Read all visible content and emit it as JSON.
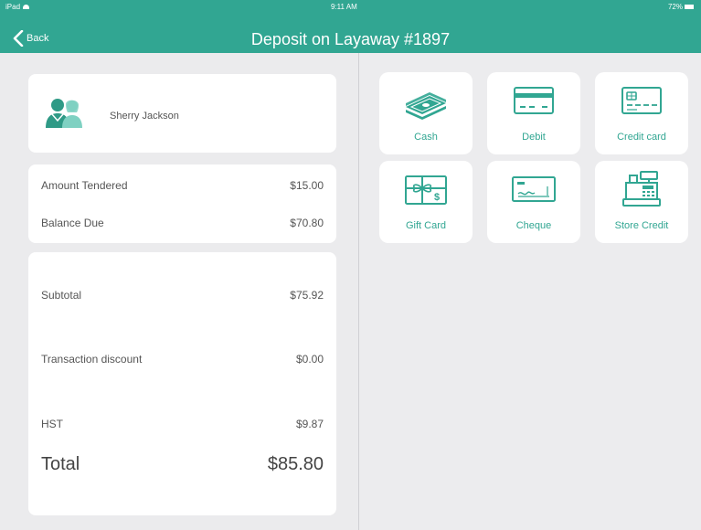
{
  "status": {
    "device": "iPad",
    "time": "9:11 AM",
    "battery": "72%"
  },
  "header": {
    "back_label": "Back",
    "title": "Deposit on Layaway #1897"
  },
  "customer": {
    "name": "Sherry Jackson"
  },
  "tender": {
    "amount_tendered_label": "Amount Tendered",
    "amount_tendered_value": "$15.00",
    "balance_due_label": "Balance Due",
    "balance_due_value": "$70.80"
  },
  "totals": {
    "subtotal_label": "Subtotal",
    "subtotal_value": "$75.92",
    "discount_label": "Transaction discount",
    "discount_value": "$0.00",
    "tax_label": "HST",
    "tax_value": "$9.87",
    "total_label": "Total",
    "total_value": "$85.80"
  },
  "payment_methods": [
    {
      "label": "Cash",
      "icon": "cash-icon"
    },
    {
      "label": "Debit",
      "icon": "debit-card-icon"
    },
    {
      "label": "Credit card",
      "icon": "credit-card-icon"
    },
    {
      "label": "Gift Card",
      "icon": "gift-card-icon"
    },
    {
      "label": "Cheque",
      "icon": "cheque-icon"
    },
    {
      "label": "Store Credit",
      "icon": "cash-register-icon"
    }
  ],
  "colors": {
    "accent": "#31a692",
    "background": "#ebebed",
    "card": "#ffffff"
  }
}
